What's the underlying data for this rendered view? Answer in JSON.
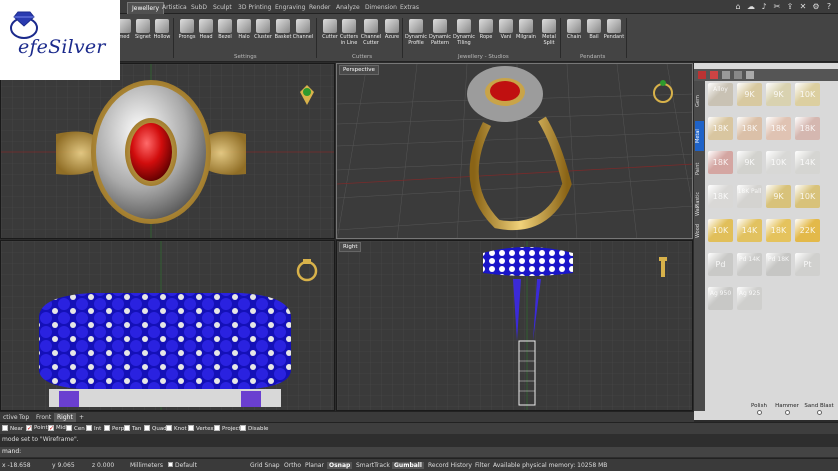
{
  "logo": {
    "text": "efeSilver"
  },
  "tabs": [
    {
      "label": "Jewellery",
      "active": true
    },
    {
      "label": "Artistica"
    },
    {
      "label": "SubD"
    },
    {
      "label": "Sculpt"
    },
    {
      "label": "3D Printing"
    },
    {
      "label": "Engraving"
    },
    {
      "label": "Render"
    },
    {
      "label": "Analyze"
    },
    {
      "label": "Dimension"
    },
    {
      "label": "Extras"
    }
  ],
  "ribbon": {
    "buttons": [
      {
        "label": "med"
      },
      {
        "label": "Signet"
      },
      {
        "label": "Hollow"
      },
      {
        "label": "Prongs"
      },
      {
        "label": "Head"
      },
      {
        "label": "Bezel"
      },
      {
        "label": "Halo"
      },
      {
        "label": "Cluster"
      },
      {
        "label": "Basket"
      },
      {
        "label": "Channel"
      },
      {
        "label": "Cutter"
      },
      {
        "label": "Cutters in Line"
      },
      {
        "label": "Channel Cutter"
      },
      {
        "label": "Azure"
      },
      {
        "label": "Dynamic Profile"
      },
      {
        "label": "Dynamic Pattern"
      },
      {
        "label": "Dynamic Tiling"
      },
      {
        "label": "Rope"
      },
      {
        "label": "Vani"
      },
      {
        "label": "Milgrain"
      },
      {
        "label": "Metal Split"
      },
      {
        "label": "Chain"
      },
      {
        "label": "Bail"
      },
      {
        "label": "Pendant"
      }
    ],
    "groups": [
      "Settings",
      "Cutters",
      "Jewellery - Studios",
      "Pendants"
    ]
  },
  "viewports": {
    "perspective": "Perspective",
    "right": "Right"
  },
  "material_panel": {
    "side_tabs": [
      "Gem",
      "Metal",
      "Paint",
      "Plastic",
      "Wax",
      "Wood"
    ],
    "active_side_tab": "Metal",
    "swatches": [
      {
        "label": "Alloy",
        "color": "#c9c2b4"
      },
      {
        "label": "9K",
        "color": "#d8c9a0"
      },
      {
        "label": "9K",
        "color": "#d9d2b0"
      },
      {
        "label": "10K",
        "color": "#dccfa0"
      },
      {
        "label": "18K",
        "color": "#d9c6a0"
      },
      {
        "label": "18K",
        "color": "#dbc0a8"
      },
      {
        "label": "18K",
        "color": "#e0c3b3"
      },
      {
        "label": "18K",
        "color": "#d5b7b0"
      },
      {
        "label": "18K",
        "color": "#d4a6a2"
      },
      {
        "label": "9K",
        "color": "#d2d2ce"
      },
      {
        "label": "10K",
        "color": "#d8d8d6"
      },
      {
        "label": "14K",
        "color": "#d5d5d2"
      },
      {
        "label": "18K",
        "color": "#d9d8d6"
      },
      {
        "label": "18K Pall",
        "color": "#d4d3d0"
      },
      {
        "label": "9K",
        "color": "#d8c27a"
      },
      {
        "label": "10K",
        "color": "#d8c27a"
      },
      {
        "label": "10K",
        "color": "#e1bf5a"
      },
      {
        "label": "14K",
        "color": "#e2c260"
      },
      {
        "label": "18K",
        "color": "#e5c35d"
      },
      {
        "label": "22K",
        "color": "#e3b94a"
      },
      {
        "label": "Pd",
        "color": "#c9c9c7"
      },
      {
        "label": "Pd 14K",
        "color": "#cacac8"
      },
      {
        "label": "Pd 18K",
        "color": "#c6c6c4"
      },
      {
        "label": "Pt",
        "color": "#d0d0ce"
      },
      {
        "label": "Ag 950",
        "color": "#c8c8c6"
      },
      {
        "label": "Ag 925",
        "color": "#cfcfcd"
      }
    ],
    "finish": [
      "Polish",
      "Hammer",
      "Sand Blast"
    ]
  },
  "viewport_tabs": [
    "ctive",
    "Top",
    "Front",
    "Right"
  ],
  "active_viewport_tab": "Right",
  "osnaps": [
    {
      "label": "Near",
      "on": false
    },
    {
      "label": "Point",
      "on": true
    },
    {
      "label": "Mid",
      "on": true
    },
    {
      "label": "Cen",
      "on": false
    },
    {
      "label": "Int",
      "on": false
    },
    {
      "label": "Perp",
      "on": false
    },
    {
      "label": "Tan",
      "on": false
    },
    {
      "label": "Quad",
      "on": false
    },
    {
      "label": "Knot",
      "on": false
    },
    {
      "label": "Vertex",
      "on": false
    },
    {
      "label": "Project",
      "on": false
    },
    {
      "label": "Disable",
      "on": false
    }
  ],
  "command": {
    "history": "mode set to \"Wireframe\".",
    "prompt": "mand:"
  },
  "status": {
    "x": "x -18.658",
    "y": "y 9.065",
    "z": "z 0.000",
    "units": "Millimeters",
    "layer": "Default",
    "grid_snap": "Grid Snap",
    "ortho": "Ortho",
    "planar": "Planar",
    "osnap": "Osnap",
    "smarttrack": "SmartTrack",
    "gumball": "Gumball",
    "record_history": "Record History",
    "filter": "Filter",
    "memory": "Available physical memory: 10258 MB"
  }
}
